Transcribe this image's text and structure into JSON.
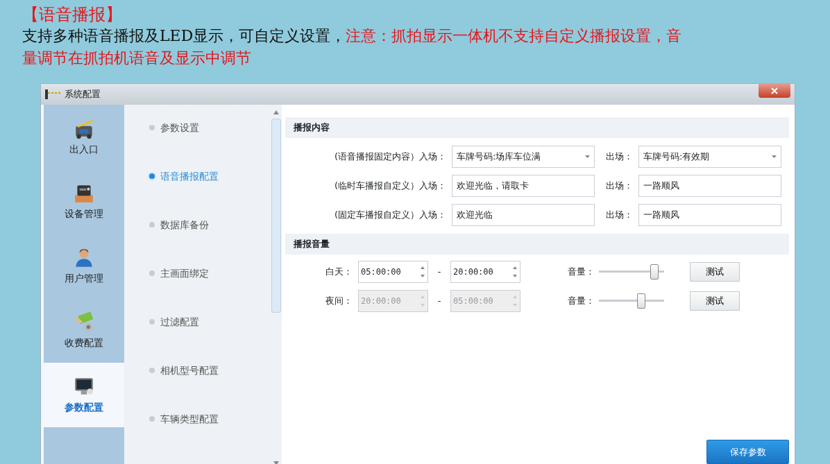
{
  "slide": {
    "title": "【语音播报】",
    "description": [
      {
        "text": "支持多种语音播报及LED显示，可自定义设置，",
        "kind": "normal"
      },
      {
        "text": "注意：抓拍显示一体机不支持自定义播报设置，音量调节在抓拍机语音及显示中调节",
        "kind": "warning"
      }
    ]
  },
  "window": {
    "title": "系统配置",
    "nav": [
      {
        "label": "出入口",
        "selected": false
      },
      {
        "label": "设备管理",
        "selected": false
      },
      {
        "label": "用户管理",
        "selected": false
      },
      {
        "label": "收费配置",
        "selected": false
      },
      {
        "label": "参数配置",
        "selected": true
      }
    ],
    "subnav": [
      {
        "label": "参数设置",
        "selected": false
      },
      {
        "label": "语音播报配置",
        "selected": true
      },
      {
        "label": "数据库备份",
        "selected": false
      },
      {
        "label": "主画面绑定",
        "selected": false
      },
      {
        "label": "过滤配置",
        "selected": false
      },
      {
        "label": "相机型号配置",
        "selected": false
      },
      {
        "label": "车辆类型配置",
        "selected": false
      }
    ],
    "content_section": {
      "title": "播报内容",
      "rows": [
        {
          "label": "(语音播报固定内容）入场：",
          "entry": {
            "kind": "select",
            "value": "车牌号码:场库车位满"
          },
          "exit_label": "出场：",
          "exit": {
            "kind": "select",
            "value": "车牌号码:有效期"
          }
        },
        {
          "label": "(临时车播报自定义）入场：",
          "entry": {
            "kind": "input",
            "value": "欢迎光临，请取卡"
          },
          "exit_label": "出场：",
          "exit": {
            "kind": "input",
            "value": "一路顺风"
          }
        },
        {
          "label": "(固定车播报自定义）入场：",
          "entry": {
            "kind": "input",
            "value": "欢迎光临"
          },
          "exit_label": "出场：",
          "exit": {
            "kind": "input",
            "value": "一路顺风"
          }
        }
      ]
    },
    "volume_section": {
      "title": "播报音量",
      "rows": [
        {
          "label": "白天：",
          "from": "05:00:00",
          "separator": "-",
          "to": "20:00:00",
          "disabled": false,
          "volume_label": "音量：",
          "level": 0.85,
          "button": "测试"
        },
        {
          "label": "夜间：",
          "from": "20:00:00",
          "separator": "-",
          "to": "05:00:00",
          "disabled": true,
          "volume_label": "音量：",
          "level": 0.65,
          "button": "测试"
        }
      ]
    },
    "save_button": "保存参数"
  }
}
